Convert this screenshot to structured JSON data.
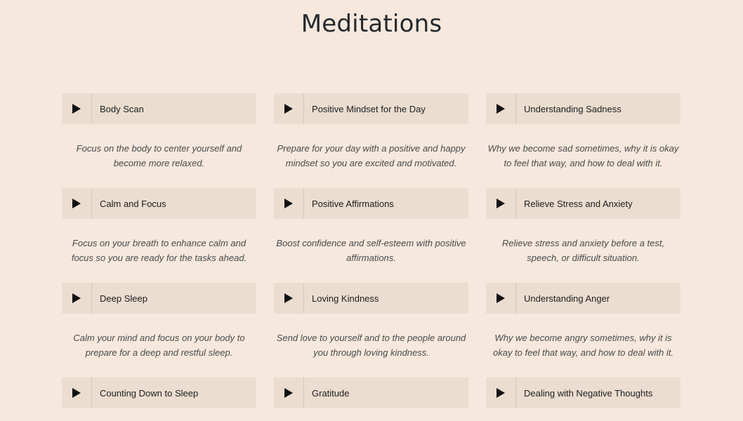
{
  "page": {
    "title": "Meditations"
  },
  "theme": {
    "background": "#f6e8dc",
    "card": "#ebddd0",
    "title_color": "#23292e"
  },
  "meditations": [
    {
      "title": "Body Scan",
      "description": "Focus on the body to center yourself and become more relaxed.",
      "icon": "play-icon"
    },
    {
      "title": "Positive Mindset for the Day",
      "description": "Prepare for your day with a positive and happy mindset so you are excited and motivated.",
      "icon": "play-icon"
    },
    {
      "title": "Understanding Sadness",
      "description": "Why we become sad sometimes, why it is okay to feel that way, and how to deal with it.",
      "icon": "play-icon"
    },
    {
      "title": "Calm and Focus",
      "description": "Focus on your breath to enhance calm and focus so you are ready for the tasks ahead.",
      "icon": "play-icon"
    },
    {
      "title": "Positive Affirmations",
      "description": "Boost confidence and self-esteem with positive affirmations.",
      "icon": "play-icon"
    },
    {
      "title": "Relieve Stress and Anxiety",
      "description": "Relieve stress and anxiety before a test, speech, or difficult situation.",
      "icon": "play-icon"
    },
    {
      "title": "Deep Sleep",
      "description": "Calm your mind and focus on your body to prepare for a deep and restful sleep.",
      "icon": "play-icon"
    },
    {
      "title": "Loving Kindness",
      "description": "Send love to yourself and to the people around you through loving kindness.",
      "icon": "play-icon"
    },
    {
      "title": "Understanding Anger",
      "description": "Why we become angry sometimes, why it is okay to feel that way, and how to deal with it.",
      "icon": "play-icon"
    },
    {
      "title": "Counting Down to Sleep",
      "description": "",
      "icon": "play-icon"
    },
    {
      "title": "Gratitude",
      "description": "",
      "icon": "play-icon"
    },
    {
      "title": "Dealing with Negative Thoughts",
      "description": "",
      "icon": "play-icon"
    }
  ]
}
